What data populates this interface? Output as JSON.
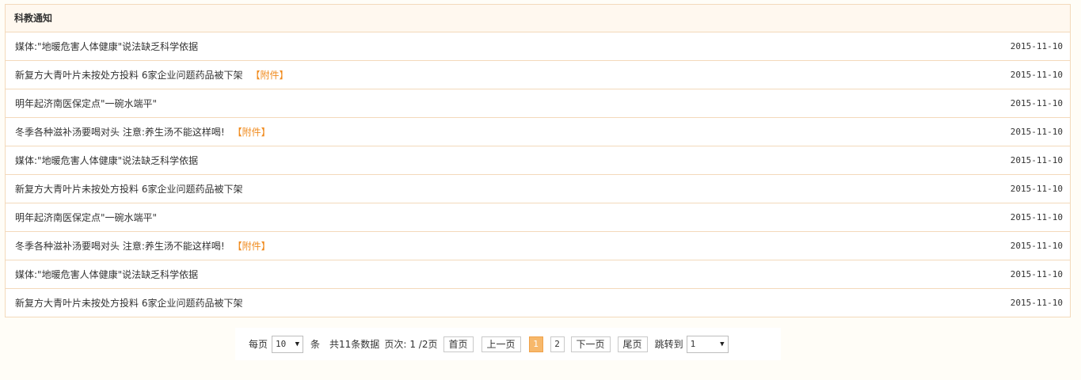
{
  "panel": {
    "title": "科教通知"
  },
  "notices": [
    {
      "title": "媒体:\"地暖危害人体健康\"说法缺乏科学依据",
      "attachment": "",
      "date": "2015-11-10"
    },
    {
      "title": "新复方大青叶片未按处方投料 6家企业问题药品被下架",
      "attachment": "【附件】",
      "date": "2015-11-10"
    },
    {
      "title": "明年起济南医保定点\"一碗水端平\"",
      "attachment": "",
      "date": "2015-11-10"
    },
    {
      "title": "冬季各种滋补汤要喝对头 注意:养生汤不能这样喝!",
      "attachment": "【附件】",
      "date": "2015-11-10"
    },
    {
      "title": "媒体:\"地暖危害人体健康\"说法缺乏科学依据",
      "attachment": "",
      "date": "2015-11-10"
    },
    {
      "title": "新复方大青叶片未按处方投料 6家企业问题药品被下架",
      "attachment": "",
      "date": "2015-11-10"
    },
    {
      "title": "明年起济南医保定点\"一碗水端平\"",
      "attachment": "",
      "date": "2015-11-10"
    },
    {
      "title": "冬季各种滋补汤要喝对头 注意:养生汤不能这样喝!",
      "attachment": "【附件】",
      "date": "2015-11-10"
    },
    {
      "title": "媒体:\"地暖危害人体健康\"说法缺乏科学依据",
      "attachment": "",
      "date": "2015-11-10"
    },
    {
      "title": "新复方大青叶片未按处方投料 6家企业问题药品被下架",
      "attachment": "",
      "date": "2015-11-10"
    }
  ],
  "pager": {
    "per_page_label": "每页",
    "per_page_value": "10",
    "per_page_unit": "条",
    "total_text": "共11条数据",
    "page_info_label": "页次:",
    "page_info_value": "1 /2页",
    "first_label": "首页",
    "prev_label": "上一页",
    "pages": [
      "1",
      "2"
    ],
    "current_page": "1",
    "next_label": "下一页",
    "last_label": "尾页",
    "jump_label": "跳转到",
    "jump_value": "1",
    "dropdown_icon": "triangle-down-icon"
  },
  "colors": {
    "border": "#f3d9bb",
    "header_bg": "#fff8ef",
    "attachment": "#f08a1c",
    "active_page": "#f7b86b"
  }
}
